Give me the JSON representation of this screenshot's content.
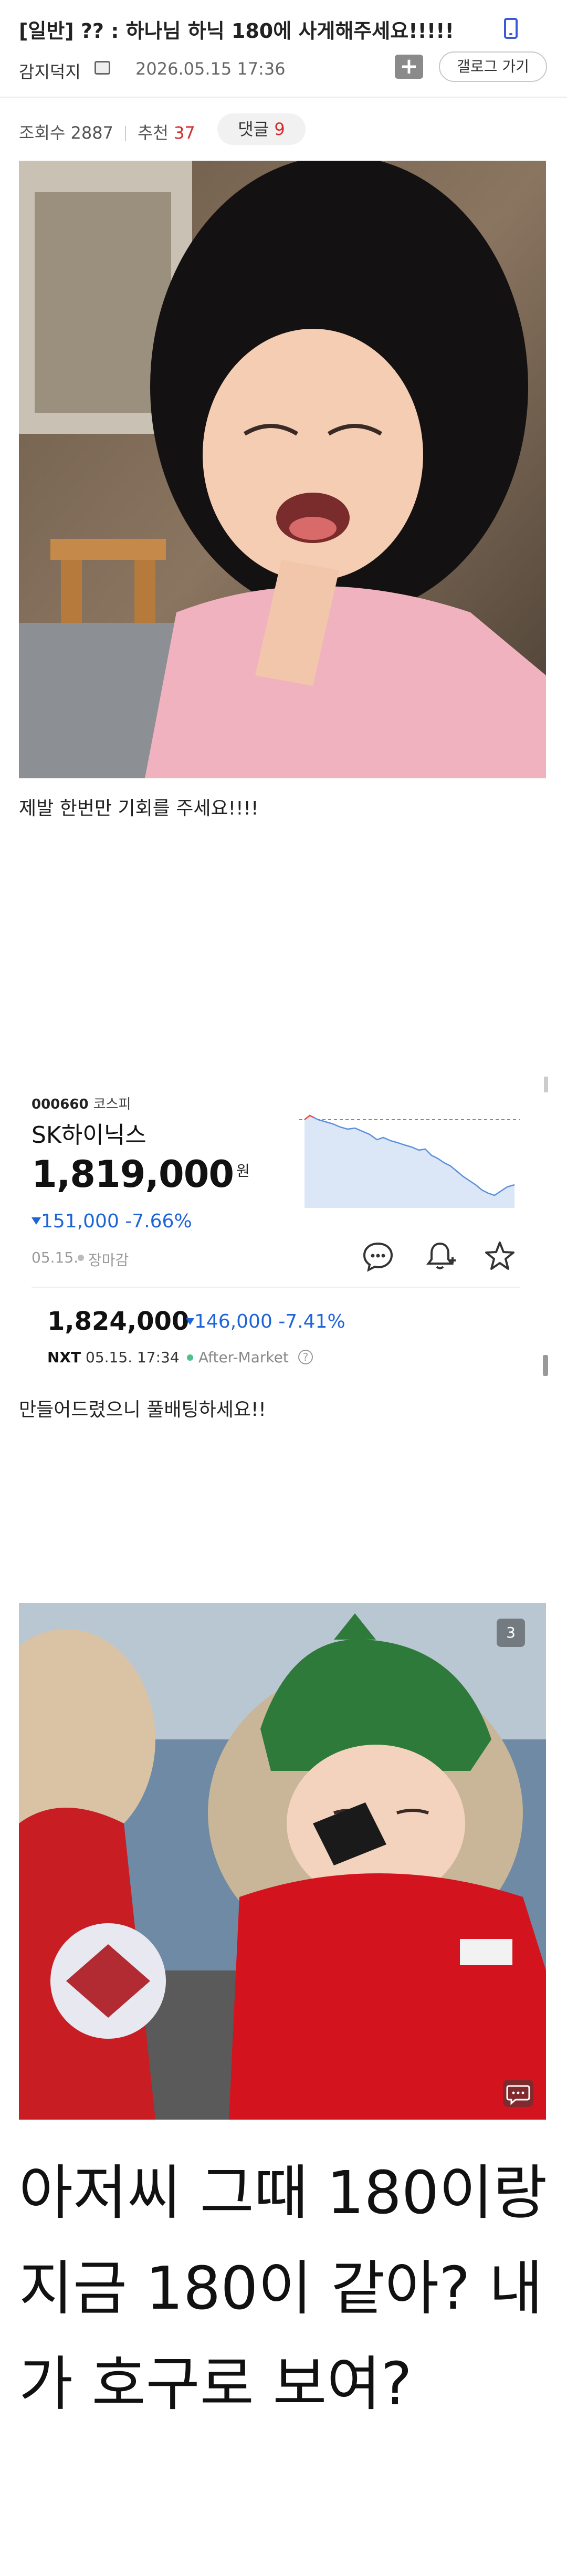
{
  "post": {
    "title": "[일반] ?? : 하나님 하닉 180에 사게해주세요!!!!!",
    "author": "감지덕지",
    "date": "2026.05.15 17:36",
    "gallery_button": "갤로그 가기",
    "plus_button": "+",
    "views_label": "조회수",
    "views": "2887",
    "recommend_label": "추천",
    "recommend": "37",
    "comments_label": "댓글",
    "comments": "9"
  },
  "body": {
    "caption1": "제발 한번만 기회를 주세요!!!!",
    "caption2": "만들어드렸으니 풀배팅하세요!!",
    "image2_badge": "3",
    "big_text": "아저씨 그때 180이랑 지금 180이 같아? 내가 호구로 보여?"
  },
  "stock": {
    "code": "000660",
    "market": "코스피",
    "name": "SK하이닉스",
    "price": "1,819,000",
    "unit": "원",
    "change": "151,000 -7.66%",
    "market_date": "05.15.",
    "market_status": "장마감",
    "after_price": "1,824,000",
    "after_change": "146,000 -7.41%",
    "nxt_label": "NXT",
    "nxt_time": "05.15. 17:34",
    "after_market": "After-Market",
    "help": "?",
    "chart_line_color": "#5b8fd8",
    "chart_fill_color": "#dbe7f7",
    "down_color": "#1d64d8"
  },
  "icons": {
    "phone": "mobile-phone-icon",
    "comment": "speech-bubble-icon",
    "alert": "bell-plus-icon",
    "favorite": "star-icon",
    "chat": "chat-bubble-icon"
  }
}
